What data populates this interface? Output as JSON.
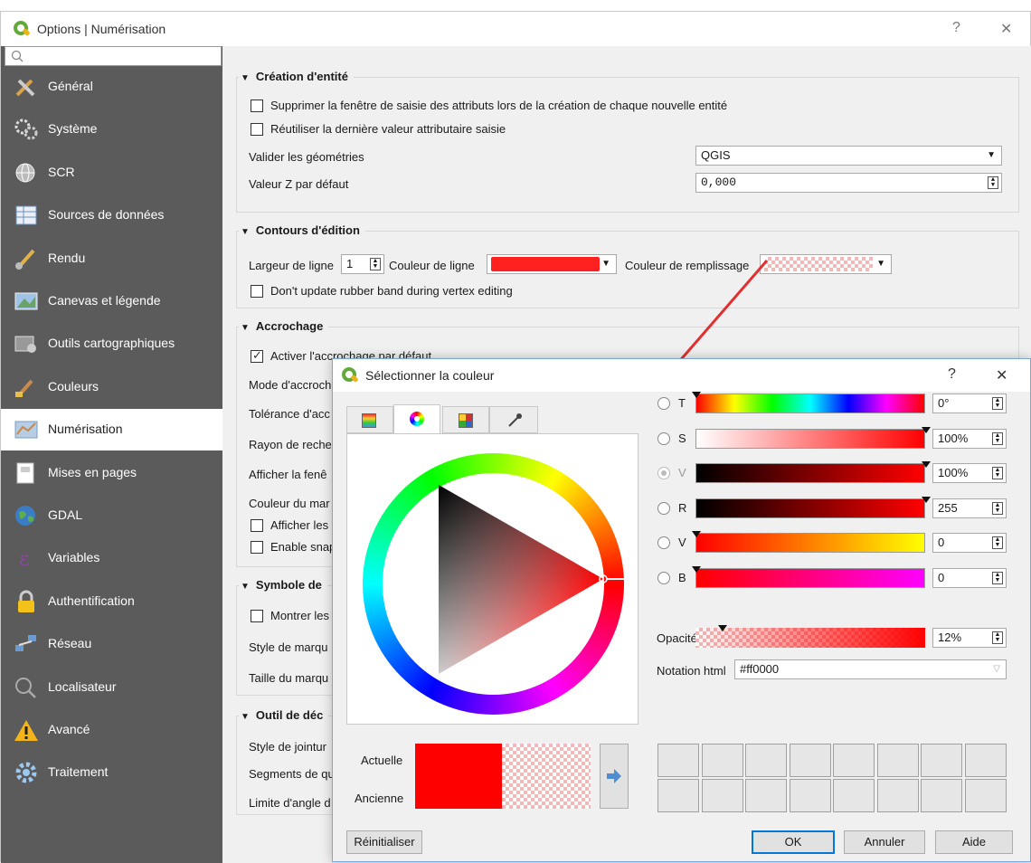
{
  "window": {
    "title": "Options | Numérisation",
    "help": "?",
    "close": "✕"
  },
  "sidebar": {
    "search_placeholder": "",
    "items": [
      {
        "label": "Général",
        "icon": "tools-icon"
      },
      {
        "label": "Système",
        "icon": "gears-icon"
      },
      {
        "label": "SCR",
        "icon": "globe-grid-icon"
      },
      {
        "label": "Sources de données",
        "icon": "table-icon"
      },
      {
        "label": "Rendu",
        "icon": "brush-icon"
      },
      {
        "label": "Canevas et légende",
        "icon": "map-canvas-icon"
      },
      {
        "label": "Outils cartographiques",
        "icon": "map-tools-icon"
      },
      {
        "label": "Couleurs",
        "icon": "paint-brush-icon"
      },
      {
        "label": "Numérisation",
        "icon": "digitize-icon"
      },
      {
        "label": "Mises en pages",
        "icon": "layout-icon"
      },
      {
        "label": "GDAL",
        "icon": "earth-icon"
      },
      {
        "label": "Variables",
        "icon": "epsilon-icon"
      },
      {
        "label": "Authentification",
        "icon": "padlock-icon"
      },
      {
        "label": "Réseau",
        "icon": "network-icon"
      },
      {
        "label": "Localisateur",
        "icon": "magnifier-icon"
      },
      {
        "label": "Avancé",
        "icon": "warning-icon"
      },
      {
        "label": "Traitement",
        "icon": "cog-icon"
      }
    ],
    "active_index": 8
  },
  "creation": {
    "title": "Création d'entité",
    "suppress_label": "Supprimer la fenêtre de saisie des attributs lors de la création de chaque nouvelle entité",
    "reuse_label": "Réutiliser la dernière valeur attributaire saisie",
    "validate_label": "Valider les géométries",
    "validate_value": "QGIS",
    "z_label": "Valeur Z par défaut",
    "z_value": "0,000"
  },
  "rubber": {
    "title": "Contours d'édition",
    "width_label": "Largeur de ligne",
    "width_value": "1",
    "line_color_label": "Couleur de ligne",
    "fill_color_label": "Couleur de remplissage",
    "no_update_label": "Don't update rubber band during vertex editing",
    "line_color": "#ff2020"
  },
  "snapping": {
    "title": "Accrochage",
    "enable_label": "Activer l'accrochage par défaut",
    "rows": [
      "Mode d'accroch",
      "Tolérance d'acc",
      "Rayon de reche",
      "Afficher la fenê",
      "Couleur du mar"
    ],
    "cb1": "Afficher les",
    "cb2": "Enable snap"
  },
  "symbol": {
    "title": "Symbole de",
    "show_label": "Montrer les",
    "style_label": "Style de marqu",
    "size_label": "Taille du marqu"
  },
  "offset": {
    "title": "Outil de déc",
    "join_label": "Style de jointur",
    "segments_label": "Segments de qu",
    "angle_label": "Limite d'angle d"
  },
  "dialog": {
    "title": "Sélectionner la couleur",
    "help": "?",
    "close": "✕",
    "tabs": [
      "color-ramp-icon",
      "color-wheel-icon",
      "swatch-grid-icon",
      "eyedropper-icon"
    ],
    "channels": [
      {
        "label": "T",
        "value": "0°",
        "level": 0
      },
      {
        "label": "S",
        "value": "100%",
        "level": 1
      },
      {
        "label": "V",
        "value": "100%",
        "level": 1
      },
      {
        "label": "R",
        "value": "255",
        "level": 1
      },
      {
        "label": "V",
        "value": "0",
        "level": 0
      },
      {
        "label": "B",
        "value": "0",
        "level": 0
      }
    ],
    "opacity_label": "Opacité",
    "opacity_value": "12%",
    "opacity_level": 0.12,
    "html_label": "Notation html",
    "html_value": "#ff0000",
    "current_label": "Actuelle",
    "old_label": "Ancienne",
    "current_color": "#ff0000",
    "reset_label": "Réinitialiser",
    "ok_label": "OK",
    "cancel_label": "Annuler",
    "help_label": "Aide"
  },
  "accent_color": "#e03030"
}
